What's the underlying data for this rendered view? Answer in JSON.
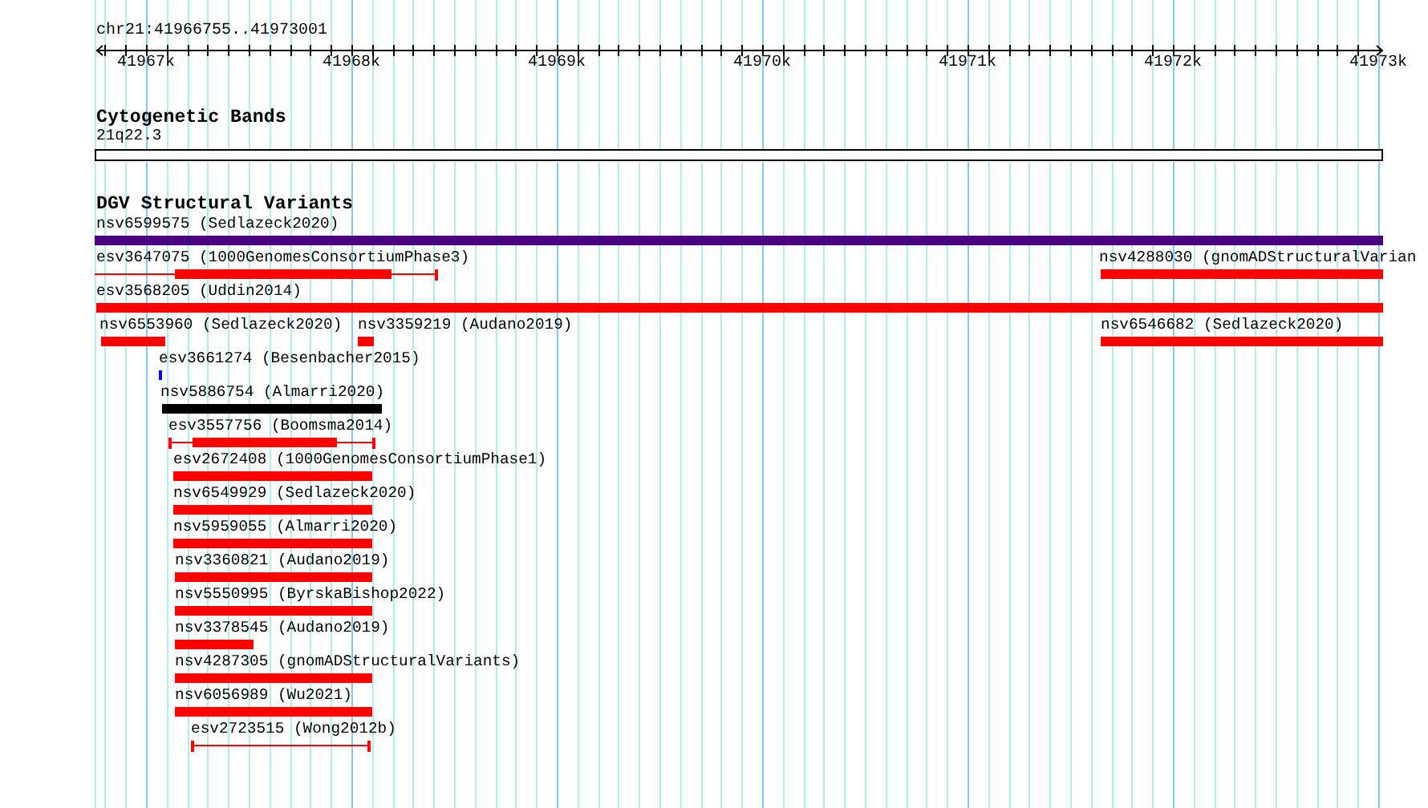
{
  "location": "chr21:41966755..41973001",
  "ruler": {
    "ticks": [
      "41967k",
      "41968k",
      "41969k",
      "41970k",
      "41971k",
      "41972k",
      "41973k"
    ]
  },
  "tracks": [
    {
      "title": "Cytogenetic Bands",
      "features": [
        {
          "label": "21q22.3",
          "kind": "band"
        }
      ]
    },
    {
      "title": "DGV Structural Variants",
      "features": [
        {
          "label": "nsv6599575 (Sedlazeck2020)",
          "kind": "solid",
          "color": "#4b0082"
        },
        {
          "label": "esv3647075 (1000GenomesConsortiumPhase3)",
          "kind": "spanned",
          "color": "#ff0000"
        },
        {
          "label": "nsv4288030 (gnomADStructuralVarian",
          "kind": "solid",
          "color": "#ff0000"
        },
        {
          "label": "esv3568205 (Uddin2014)",
          "kind": "solid",
          "color": "#ff0000"
        },
        {
          "label": "nsv6553960 (Sedlazeck2020)",
          "kind": "solid",
          "color": "#ff0000"
        },
        {
          "label": "nsv3359219 (Audano2019)",
          "kind": "solid",
          "color": "#ff0000"
        },
        {
          "label": "nsv6546682 (Sedlazeck2020)",
          "kind": "solid",
          "color": "#ff0000"
        },
        {
          "label": "esv3661274 (Besenbacher2015)",
          "kind": "solid",
          "color": "#0000ff"
        },
        {
          "label": "nsv5886754 (Almarri2020)",
          "kind": "solid",
          "color": "#000000"
        },
        {
          "label": "esv3557756 (Boomsma2014)",
          "kind": "spanned",
          "color": "#ff0000"
        },
        {
          "label": "esv2672408 (1000GenomesConsortiumPhase1)",
          "kind": "solid",
          "color": "#ff0000"
        },
        {
          "label": "nsv6549929 (Sedlazeck2020)",
          "kind": "solid",
          "color": "#ff0000"
        },
        {
          "label": "nsv5959055 (Almarri2020)",
          "kind": "solid",
          "color": "#ff0000"
        },
        {
          "label": "nsv3360821 (Audano2019)",
          "kind": "solid",
          "color": "#ff0000"
        },
        {
          "label": "nsv5550995 (ByrskaBishop2022)",
          "kind": "solid",
          "color": "#ff0000"
        },
        {
          "label": "nsv3378545 (Audano2019)",
          "kind": "solid",
          "color": "#ff0000"
        },
        {
          "label": "nsv4287305 (gnomADStructuralVariants)",
          "kind": "solid",
          "color": "#ff0000"
        },
        {
          "label": "nsv6056989 (Wu2021)",
          "kind": "solid",
          "color": "#ff0000"
        },
        {
          "label": "esv2723515 (Wong2012b)",
          "kind": "span",
          "color": "#ff0000"
        }
      ]
    }
  ]
}
